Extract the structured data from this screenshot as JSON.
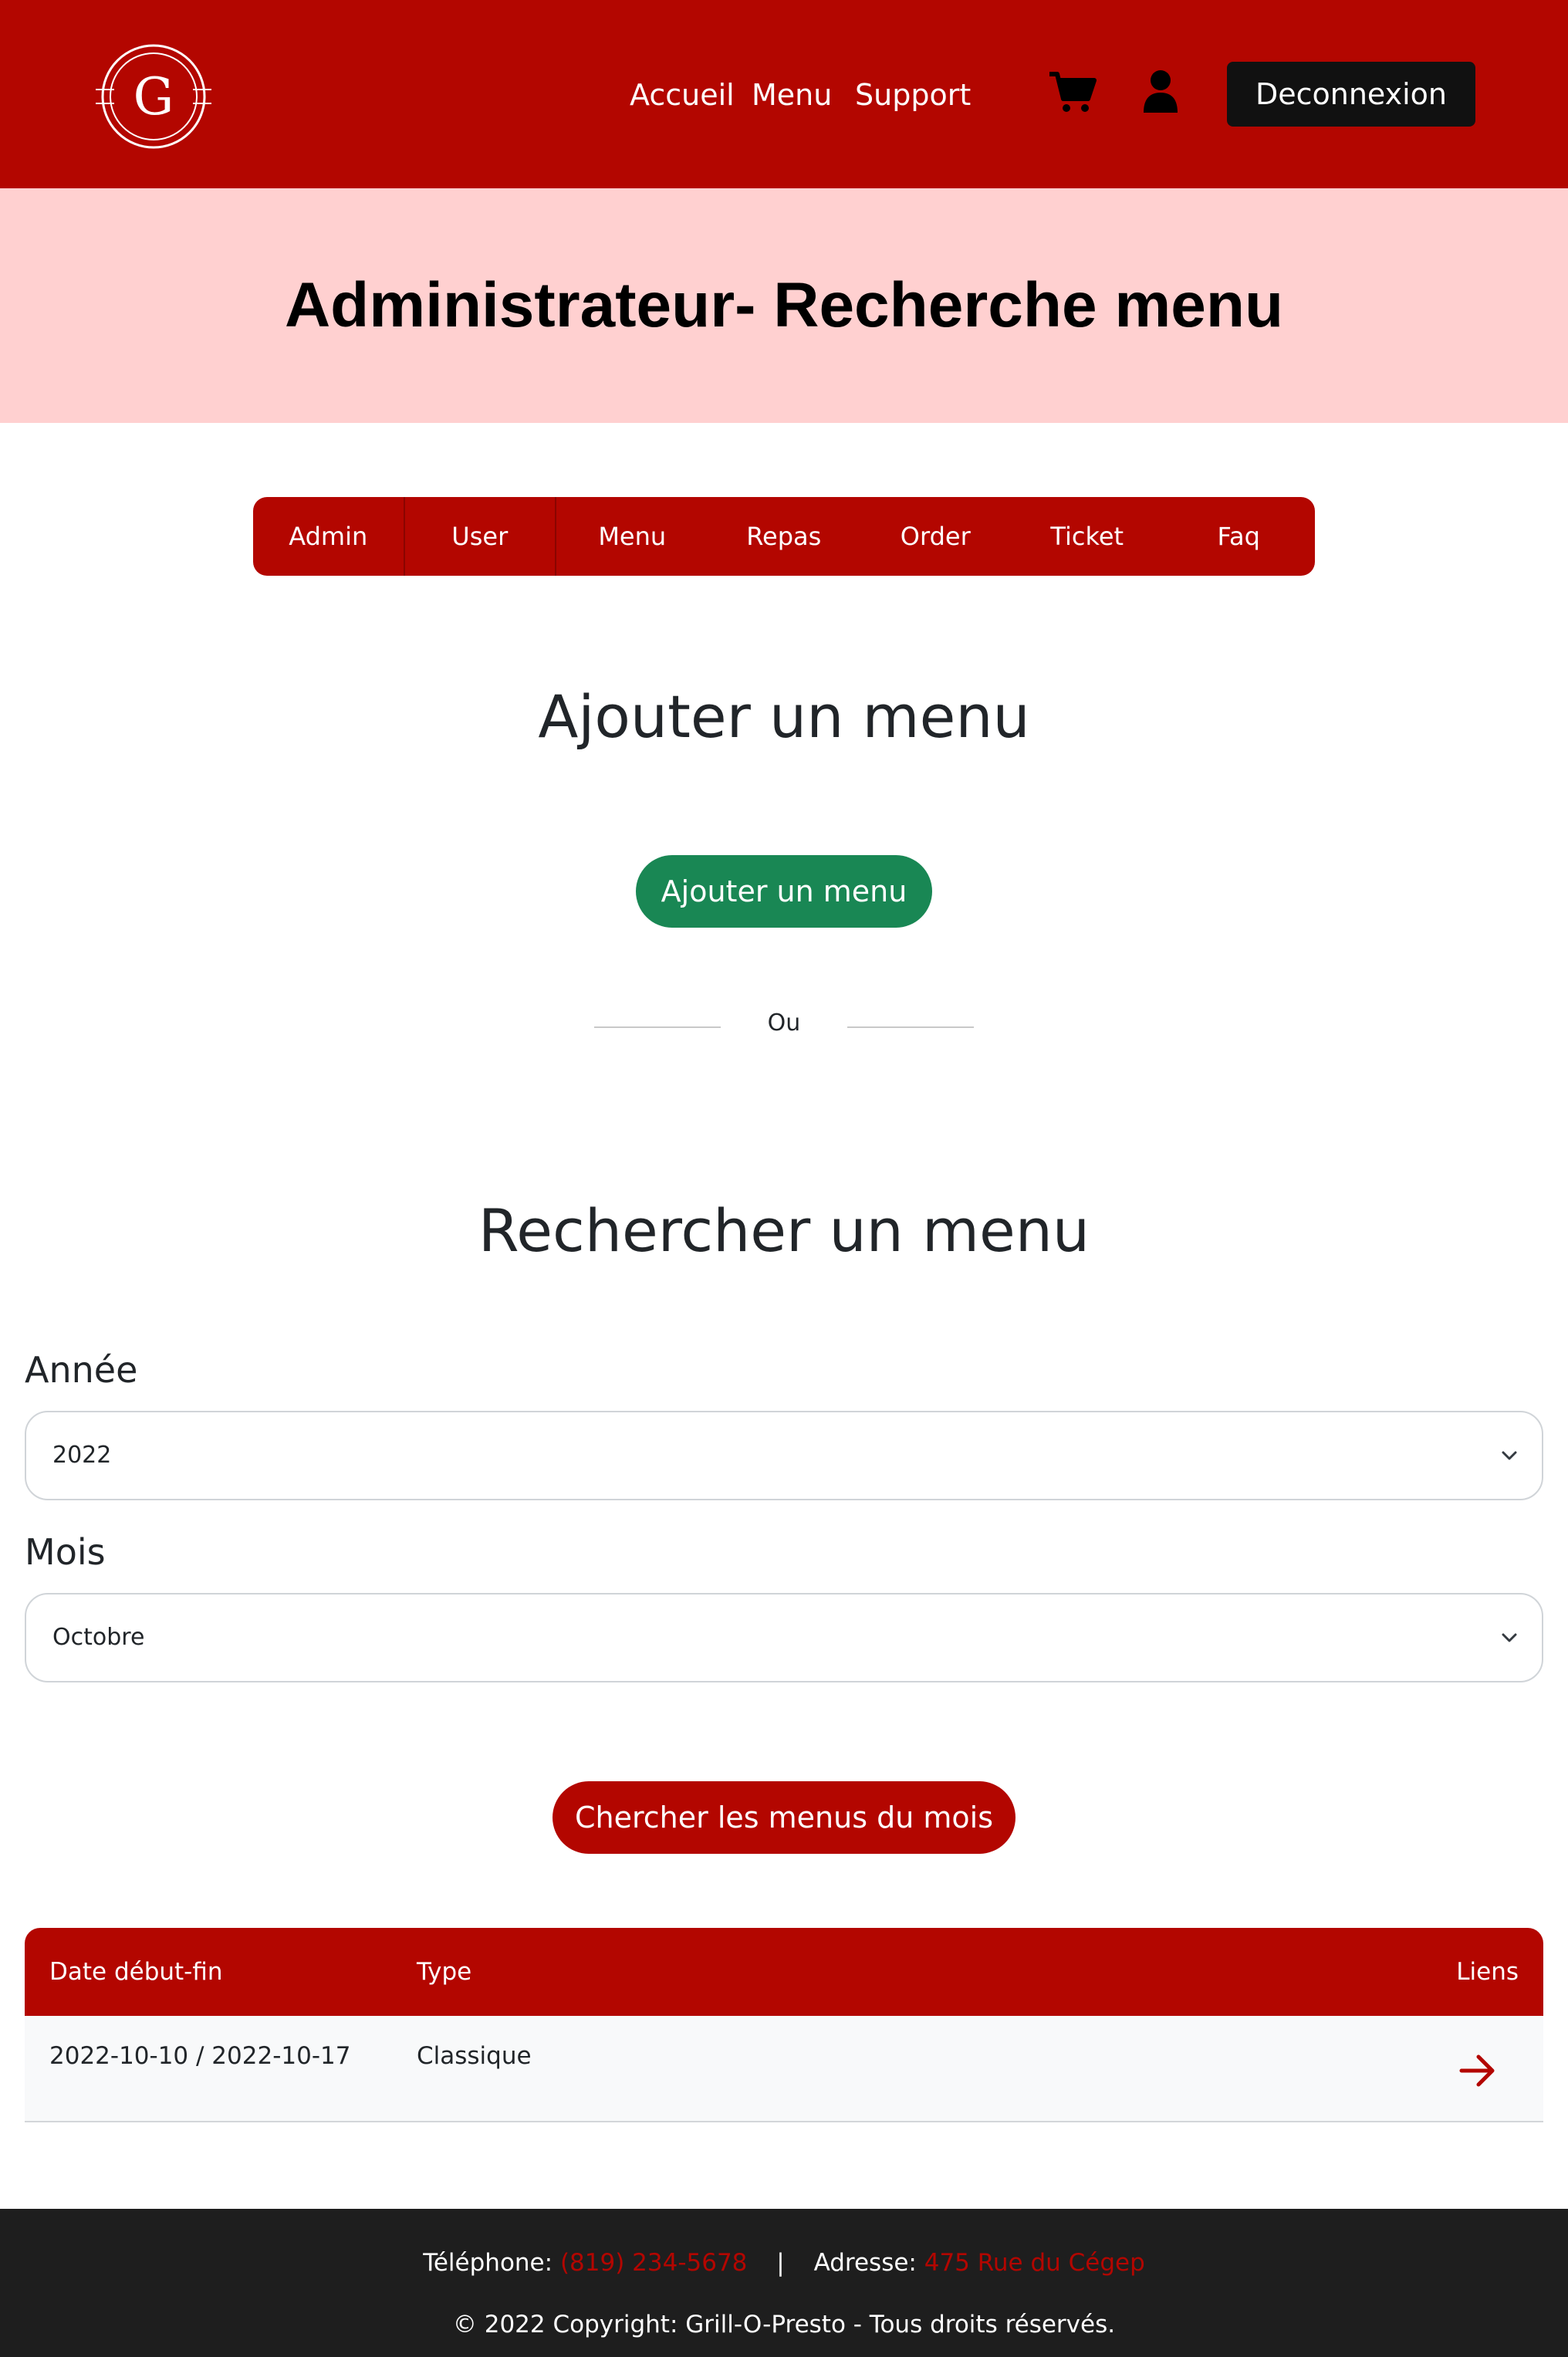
{
  "header": {
    "logo_letter": "G",
    "nav": [
      "Accueil",
      "Menu",
      "Support"
    ],
    "cart_icon": "cart-icon",
    "user_icon": "user-icon",
    "logout_label": "Deconnexion"
  },
  "banner": {
    "title": "Administrateur- Recherche menu"
  },
  "admin_tabs": [
    "Admin",
    "User",
    "Menu",
    "Repas",
    "Order",
    "Ticket",
    "Faq"
  ],
  "add_section": {
    "title": "Ajouter un menu",
    "button_label": "Ajouter un menu",
    "or_text": "Ou"
  },
  "search_section": {
    "title": "Rechercher un menu",
    "year_label": "Année",
    "year_value": "2022",
    "month_label": "Mois",
    "month_value": "Octobre",
    "button_label": "Chercher les menus du mois"
  },
  "table": {
    "headers": [
      "Date début-fin",
      "Type",
      "Liens"
    ],
    "rows": [
      {
        "dates": "2022-10-10 / 2022-10-17",
        "type": "Classique",
        "link_icon": "arrow-right-icon"
      }
    ]
  },
  "footer": {
    "phone_label": "Téléphone:",
    "phone_value": "(819) 234-5678",
    "separator": "|",
    "address_label": "Adresse:",
    "address_value": "475 Rue du Cégep",
    "copyright": "© 2022 Copyright: Grill-O-Presto - Tous droits réservés."
  },
  "colors": {
    "brand_red": "#b30600",
    "banner_pink": "#ffd0d0",
    "success_green": "#198754",
    "footer_dark": "#1e1e1e"
  }
}
